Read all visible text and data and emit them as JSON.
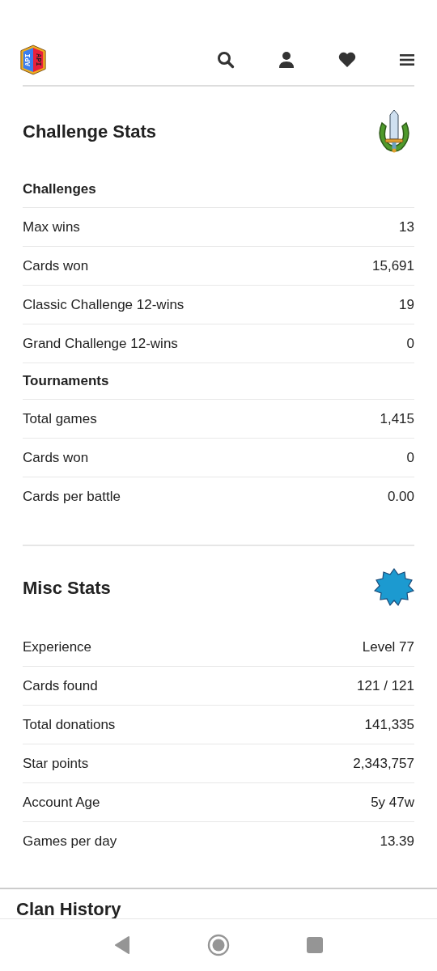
{
  "header": {
    "logo_text": [
      "API",
      "API"
    ],
    "actions": [
      {
        "kind": "search"
      },
      {
        "kind": "profile"
      },
      {
        "kind": "favorites"
      },
      {
        "kind": "menu"
      }
    ]
  },
  "sections": [
    {
      "title": "Challenge Stats",
      "badge": {
        "kind": "sword-wreath"
      },
      "rows": [
        {
          "kind": "heading",
          "label": "Challenges"
        },
        {
          "kind": "stat",
          "label": "Max wins",
          "value": "13"
        },
        {
          "kind": "stat",
          "label": "Cards won",
          "value": "15,691"
        },
        {
          "kind": "stat",
          "label": "Classic Challenge 12-wins",
          "value": "19"
        },
        {
          "kind": "stat",
          "label": "Grand Challenge 12-wins",
          "value": "0"
        },
        {
          "kind": "heading",
          "label": "Tournaments"
        },
        {
          "kind": "stat",
          "label": "Total games",
          "value": "1,415"
        },
        {
          "kind": "stat",
          "label": "Cards won",
          "value": "0"
        },
        {
          "kind": "stat",
          "label": "Cards per battle",
          "value": "0.00"
        }
      ]
    },
    {
      "title": "Misc Stats",
      "badge": {
        "kind": "star-burst"
      },
      "rows": [
        {
          "kind": "stat",
          "label": "Experience",
          "value": "Level 77"
        },
        {
          "kind": "stat",
          "label": "Cards found",
          "value": "121 / 121"
        },
        {
          "kind": "stat",
          "label": "Total donations",
          "value": "141,335"
        },
        {
          "kind": "stat",
          "label": "Star points",
          "value": "2,343,757"
        },
        {
          "kind": "stat",
          "label": "Account Age",
          "value": "5y 47w"
        },
        {
          "kind": "stat",
          "label": "Games per day",
          "value": "13.39"
        }
      ]
    }
  ],
  "next_section": {
    "title": "Clan History"
  }
}
